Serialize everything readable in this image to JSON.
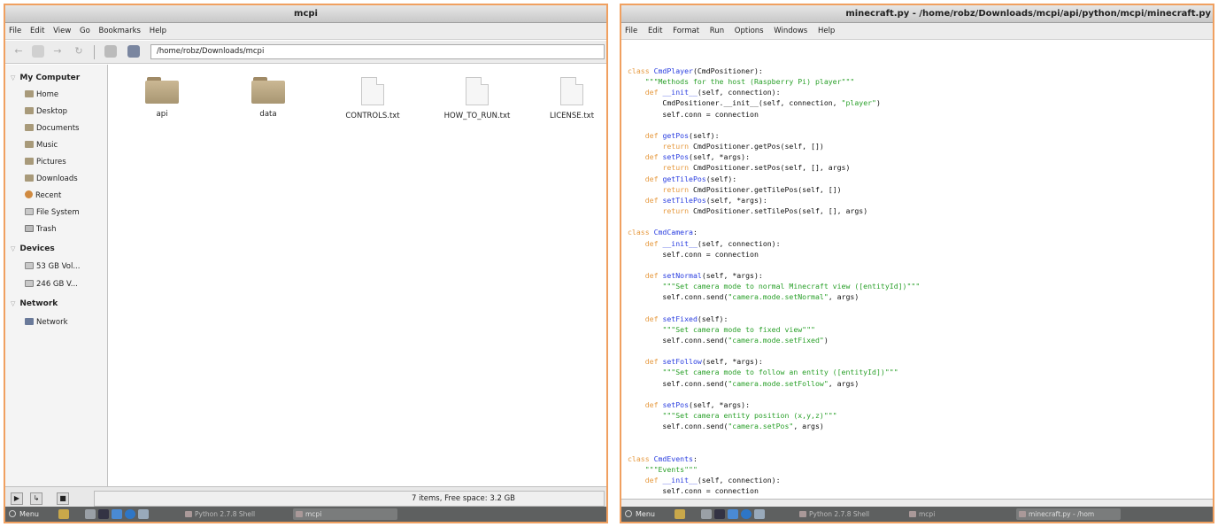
{
  "left": {
    "title": "mcpi",
    "menu": [
      "File",
      "Edit",
      "View",
      "Go",
      "Bookmarks",
      "Help"
    ],
    "location": "/home/robz/Downloads/mcpi",
    "sidebar": {
      "sections": [
        {
          "label": "My Computer",
          "items": [
            "Home",
            "Desktop",
            "Documents",
            "Music",
            "Pictures",
            "Downloads",
            "Recent",
            "File System",
            "Trash"
          ]
        },
        {
          "label": "Devices",
          "items": [
            "53 GB Vol...",
            "246 GB V..."
          ]
        },
        {
          "label": "Network",
          "items": [
            "Network"
          ]
        }
      ]
    },
    "files": [
      {
        "name": "api",
        "type": "folder"
      },
      {
        "name": "data",
        "type": "folder"
      },
      {
        "name": "CONTROLS.txt",
        "type": "text"
      },
      {
        "name": "HOW_TO_RUN.txt",
        "type": "text"
      },
      {
        "name": "LICENSE.txt",
        "type": "text"
      }
    ],
    "status": "7 items, Free space: 3.2 GB",
    "taskbar": {
      "menu": "Menu",
      "tasks": [
        "Python 2.7.8 Shell",
        "mcpi"
      ]
    }
  },
  "right": {
    "title": "minecraft.py - /home/robz/Downloads/mcpi/api/python/mcpi/minecraft.py",
    "menu": [
      "File",
      "Edit",
      "Format",
      "Run",
      "Options",
      "Windows",
      "Help"
    ],
    "code_lines": [
      [
        [
          "k",
          "class "
        ],
        [
          "f",
          "CmdPlayer"
        ],
        [
          "n",
          "(CmdPositioner):"
        ]
      ],
      [
        [
          "n",
          "    "
        ],
        [
          "s",
          "\"\"\"Methods for the host (Raspberry Pi) player\"\"\""
        ]
      ],
      [
        [
          "n",
          "    "
        ],
        [
          "k",
          "def "
        ],
        [
          "f",
          "__init__"
        ],
        [
          "n",
          "(self, connection):"
        ]
      ],
      [
        [
          "n",
          "        CmdPositioner.__init__(self, connection, "
        ],
        [
          "s",
          "\"player\""
        ],
        [
          "n",
          ")"
        ]
      ],
      [
        [
          "n",
          "        self.conn = connection"
        ]
      ],
      [
        [
          "n",
          ""
        ]
      ],
      [
        [
          "n",
          "    "
        ],
        [
          "k",
          "def "
        ],
        [
          "f",
          "getPos"
        ],
        [
          "n",
          "(self):"
        ]
      ],
      [
        [
          "n",
          "        "
        ],
        [
          "k",
          "return "
        ],
        [
          "n",
          "CmdPositioner.getPos(self, [])"
        ]
      ],
      [
        [
          "n",
          "    "
        ],
        [
          "k",
          "def "
        ],
        [
          "f",
          "setPos"
        ],
        [
          "n",
          "(self, *args):"
        ]
      ],
      [
        [
          "n",
          "        "
        ],
        [
          "k",
          "return "
        ],
        [
          "n",
          "CmdPositioner.setPos(self, [], args)"
        ]
      ],
      [
        [
          "n",
          "    "
        ],
        [
          "k",
          "def "
        ],
        [
          "f",
          "getTilePos"
        ],
        [
          "n",
          "(self):"
        ]
      ],
      [
        [
          "n",
          "        "
        ],
        [
          "k",
          "return "
        ],
        [
          "n",
          "CmdPositioner.getTilePos(self, [])"
        ]
      ],
      [
        [
          "n",
          "    "
        ],
        [
          "k",
          "def "
        ],
        [
          "f",
          "setTilePos"
        ],
        [
          "n",
          "(self, *args):"
        ]
      ],
      [
        [
          "n",
          "        "
        ],
        [
          "k",
          "return "
        ],
        [
          "n",
          "CmdPositioner.setTilePos(self, [], args)"
        ]
      ],
      [
        [
          "n",
          ""
        ]
      ],
      [
        [
          "k",
          "class "
        ],
        [
          "f",
          "CmdCamera"
        ],
        [
          "n",
          ":"
        ]
      ],
      [
        [
          "n",
          "    "
        ],
        [
          "k",
          "def "
        ],
        [
          "f",
          "__init__"
        ],
        [
          "n",
          "(self, connection):"
        ]
      ],
      [
        [
          "n",
          "        self.conn = connection"
        ]
      ],
      [
        [
          "n",
          ""
        ]
      ],
      [
        [
          "n",
          "    "
        ],
        [
          "k",
          "def "
        ],
        [
          "f",
          "setNormal"
        ],
        [
          "n",
          "(self, *args):"
        ]
      ],
      [
        [
          "n",
          "        "
        ],
        [
          "s",
          "\"\"\"Set camera mode to normal Minecraft view ([entityId])\"\"\""
        ]
      ],
      [
        [
          "n",
          "        self.conn.send("
        ],
        [
          "s",
          "\"camera.mode.setNormal\""
        ],
        [
          "n",
          ", args)"
        ]
      ],
      [
        [
          "n",
          ""
        ]
      ],
      [
        [
          "n",
          "    "
        ],
        [
          "k",
          "def "
        ],
        [
          "f",
          "setFixed"
        ],
        [
          "n",
          "(self):"
        ]
      ],
      [
        [
          "n",
          "        "
        ],
        [
          "s",
          "\"\"\"Set camera mode to fixed view\"\"\""
        ]
      ],
      [
        [
          "n",
          "        self.conn.send("
        ],
        [
          "s",
          "\"camera.mode.setFixed\""
        ],
        [
          "n",
          ")"
        ]
      ],
      [
        [
          "n",
          ""
        ]
      ],
      [
        [
          "n",
          "    "
        ],
        [
          "k",
          "def "
        ],
        [
          "f",
          "setFollow"
        ],
        [
          "n",
          "(self, *args):"
        ]
      ],
      [
        [
          "n",
          "        "
        ],
        [
          "s",
          "\"\"\"Set camera mode to follow an entity ([entityId])\"\"\""
        ]
      ],
      [
        [
          "n",
          "        self.conn.send("
        ],
        [
          "s",
          "\"camera.mode.setFollow\""
        ],
        [
          "n",
          ", args)"
        ]
      ],
      [
        [
          "n",
          ""
        ]
      ],
      [
        [
          "n",
          "    "
        ],
        [
          "k",
          "def "
        ],
        [
          "f",
          "setPos"
        ],
        [
          "n",
          "(self, *args):"
        ]
      ],
      [
        [
          "n",
          "        "
        ],
        [
          "s",
          "\"\"\"Set camera entity position (x,y,z)\"\"\""
        ]
      ],
      [
        [
          "n",
          "        self.conn.send("
        ],
        [
          "s",
          "\"camera.setPos\""
        ],
        [
          "n",
          ", args)"
        ]
      ],
      [
        [
          "n",
          ""
        ]
      ],
      [
        [
          "n",
          ""
        ]
      ],
      [
        [
          "k",
          "class "
        ],
        [
          "f",
          "CmdEvents"
        ],
        [
          "n",
          ":"
        ]
      ],
      [
        [
          "n",
          "    "
        ],
        [
          "s",
          "\"\"\"Events\"\"\""
        ]
      ],
      [
        [
          "n",
          "    "
        ],
        [
          "k",
          "def "
        ],
        [
          "f",
          "__init__"
        ],
        [
          "n",
          "(self, connection):"
        ]
      ],
      [
        [
          "n",
          "        self.conn = connection"
        ]
      ]
    ],
    "taskbar": {
      "menu": "Menu",
      "tasks": [
        "Python 2.7.8 Shell",
        "mcpi",
        "minecraft.py - /hom"
      ]
    }
  },
  "colors": {
    "frame": "#f0a060",
    "keyword": "#e69a40",
    "function": "#2a3ee0",
    "string": "#2aa02a",
    "taskbar": "#5e6060"
  }
}
